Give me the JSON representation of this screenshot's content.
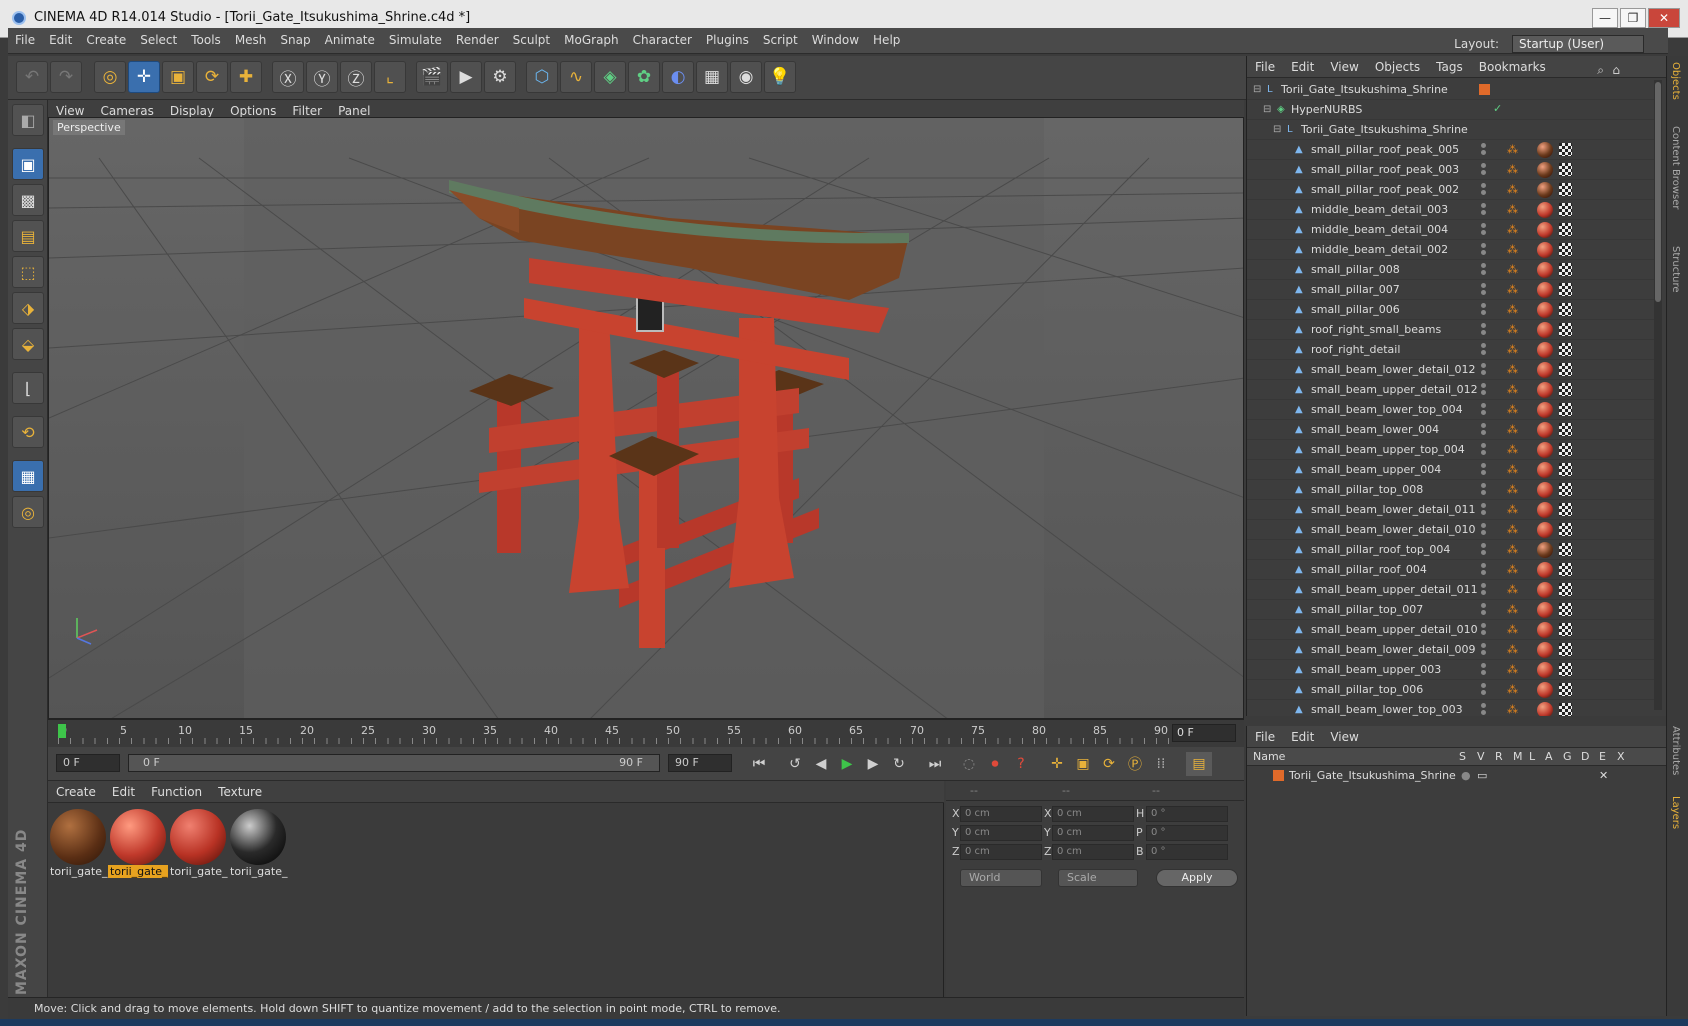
{
  "window": {
    "title": "CINEMA 4D R14.014 Studio - [Torii_Gate_Itsukushima_Shrine.c4d *]",
    "min": "—",
    "max": "❐",
    "close": "✕"
  },
  "menubar": {
    "items": [
      "File",
      "Edit",
      "Create",
      "Select",
      "Tools",
      "Mesh",
      "Snap",
      "Animate",
      "Simulate",
      "Render",
      "Sculpt",
      "MoGraph",
      "Character",
      "Plugins",
      "Script",
      "Window",
      "Help"
    ],
    "layout_label": "Layout:",
    "layout_value": "Startup (User)"
  },
  "viewport": {
    "menu": [
      "View",
      "Cameras",
      "Display",
      "Options",
      "Filter",
      "Panel"
    ],
    "label": "Perspective"
  },
  "timeline": {
    "ticks": [
      "0",
      "5",
      "10",
      "15",
      "20",
      "25",
      "30",
      "35",
      "40",
      "45",
      "50",
      "55",
      "60",
      "65",
      "70",
      "75",
      "80",
      "85",
      "90"
    ],
    "current_frame": "0 F"
  },
  "playbar": {
    "start": "0 F",
    "range_start": "0 F",
    "range_end": "90 F",
    "end": "90 F"
  },
  "materials": {
    "menu": [
      "Create",
      "Edit",
      "Function",
      "Texture"
    ],
    "items": [
      {
        "label": "torii_gate_",
        "color": "#6b3a1c",
        "selected": false
      },
      {
        "label": "torii_gate_",
        "color": "#c0392b",
        "selected": true
      },
      {
        "label": "torii_gate_",
        "color": "#b83224",
        "selected": false
      },
      {
        "label": "torii_gate_",
        "color": "#2a2a2a",
        "selected": false
      }
    ]
  },
  "attributes": {
    "headers": [
      "--",
      "--",
      "--"
    ],
    "x_label": "X",
    "y_label": "Y",
    "z_label": "Z",
    "h_label": "H",
    "p_label": "P",
    "b_label": "B",
    "pos_x": "0 cm",
    "pos_y": "0 cm",
    "pos_z": "0 cm",
    "size_x": "0 cm",
    "size_y": "0 cm",
    "size_z": "0 cm",
    "rot_h": "0 °",
    "rot_p": "0 °",
    "rot_b": "0 °",
    "coord_mode": "World",
    "size_mode": "Scale",
    "apply": "Apply"
  },
  "status": "Move: Click and drag to move elements. Hold down SHIFT to quantize movement / add to the selection in point mode, CTRL to remove.",
  "objects": {
    "menu": [
      "File",
      "Edit",
      "View",
      "Objects",
      "Tags",
      "Bookmarks"
    ],
    "root": "Torii_Gate_Itsukushima_Shrine",
    "hypernurbs": "HyperNURBS",
    "group": "Torii_Gate_Itsukushima_Shrine",
    "items": [
      {
        "name": "small_pillar_roof_peak_005",
        "mat": "#6b3a1c"
      },
      {
        "name": "small_pillar_roof_peak_003",
        "mat": "#6b3a1c"
      },
      {
        "name": "small_pillar_roof_peak_002",
        "mat": "#6b3a1c"
      },
      {
        "name": "middle_beam_detail_003",
        "mat": "#c0392b"
      },
      {
        "name": "middle_beam_detail_004",
        "mat": "#c0392b"
      },
      {
        "name": "middle_beam_detail_002",
        "mat": "#c0392b"
      },
      {
        "name": "small_pillar_008",
        "mat": "#c0392b"
      },
      {
        "name": "small_pillar_007",
        "mat": "#c0392b"
      },
      {
        "name": "small_pillar_006",
        "mat": "#c0392b"
      },
      {
        "name": "roof_right_small_beams",
        "mat": "#c0392b"
      },
      {
        "name": "roof_right_detail",
        "mat": "#c0392b"
      },
      {
        "name": "small_beam_lower_detail_012",
        "mat": "#c0392b"
      },
      {
        "name": "small_beam_upper_detail_012",
        "mat": "#c0392b"
      },
      {
        "name": "small_beam_lower_top_004",
        "mat": "#c0392b"
      },
      {
        "name": "small_beam_lower_004",
        "mat": "#c0392b"
      },
      {
        "name": "small_beam_upper_top_004",
        "mat": "#c0392b"
      },
      {
        "name": "small_beam_upper_004",
        "mat": "#c0392b"
      },
      {
        "name": "small_pillar_top_008",
        "mat": "#c0392b"
      },
      {
        "name": "small_beam_lower_detail_011",
        "mat": "#c0392b"
      },
      {
        "name": "small_beam_lower_detail_010",
        "mat": "#c0392b"
      },
      {
        "name": "small_pillar_roof_top_004",
        "mat": "#6b3a1c"
      },
      {
        "name": "small_pillar_roof_004",
        "mat": "#c0392b"
      },
      {
        "name": "small_beam_upper_detail_011",
        "mat": "#c0392b"
      },
      {
        "name": "small_pillar_top_007",
        "mat": "#c0392b"
      },
      {
        "name": "small_beam_upper_detail_010",
        "mat": "#c0392b"
      },
      {
        "name": "small_beam_lower_detail_009",
        "mat": "#c0392b"
      },
      {
        "name": "small_beam_upper_003",
        "mat": "#c0392b"
      },
      {
        "name": "small_pillar_top_006",
        "mat": "#c0392b"
      },
      {
        "name": "small_beam_lower_top_003",
        "mat": "#c0392b"
      }
    ]
  },
  "layers": {
    "menu": [
      "File",
      "Edit",
      "View"
    ],
    "headers": [
      "Name",
      "S",
      "V",
      "R",
      "M",
      "L",
      "A",
      "G",
      "D",
      "E",
      "X"
    ],
    "row": "Torii_Gate_Itsukushima_Shrine"
  },
  "sidetabs": [
    "Objects",
    "Content Browser",
    "Structure",
    "Attributes",
    "Layers"
  ],
  "branding": "MAXON CINEMA 4D",
  "colors": {
    "accent": "#e8b23a",
    "selected_blue": "#3a6fae",
    "gate_red": "#c8432f"
  }
}
